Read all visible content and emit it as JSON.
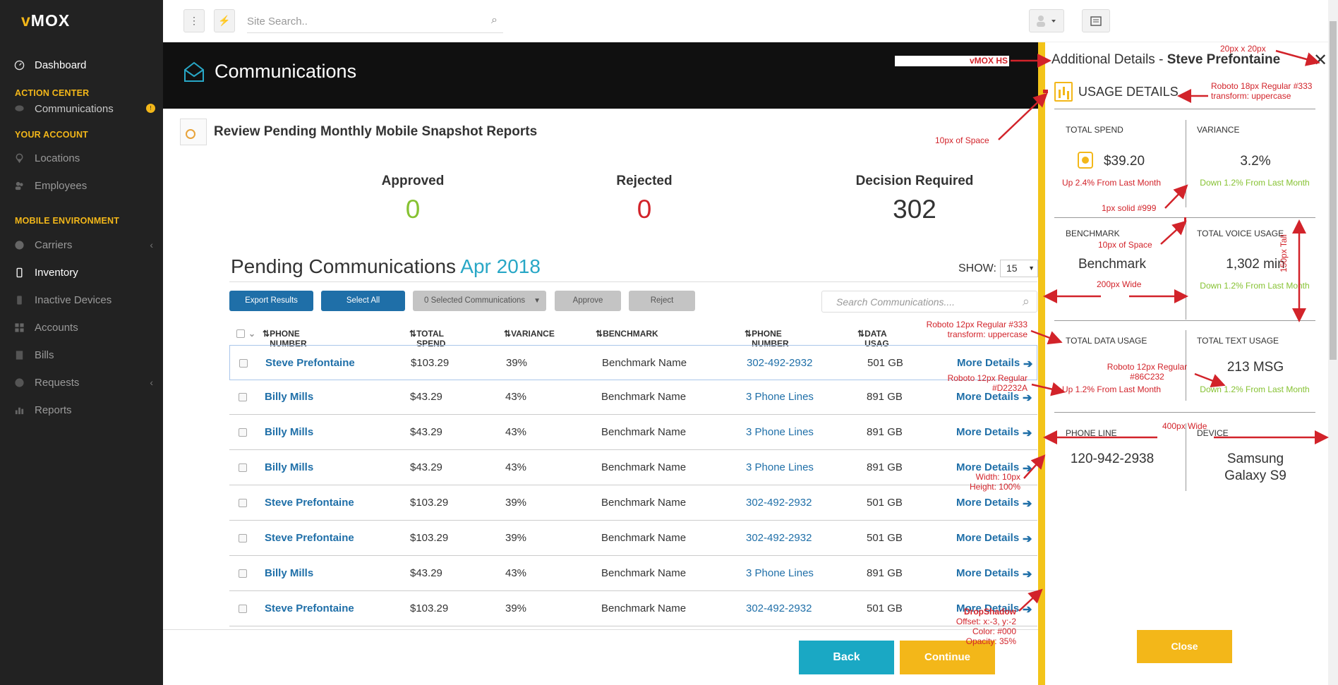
{
  "brand": {
    "logo_v": "v",
    "logo_rest": "MOX",
    "accent": "#f3b719"
  },
  "sidebar": {
    "dashboard": "Dashboard",
    "action_center": "ACTION CENTER",
    "communications": "Communications",
    "communications_badge": "!",
    "your_account": "YOUR ACCOUNT",
    "locations": "Locations",
    "employees": "Employees",
    "mobile_environment": "MOBILE ENVIRONMENT",
    "carriers": "Carriers",
    "inventory": "Inventory",
    "inactive_devices": "Inactive Devices",
    "accounts": "Accounts",
    "bills": "Bills",
    "requests": "Requests",
    "reports": "Reports",
    "chevron": "‹"
  },
  "topbar": {
    "menu_glyph": "⋮",
    "bolt_glyph": "⚡",
    "search_placeholder": "Site Search..",
    "search_glyph": "⌕"
  },
  "header": {
    "title": "Communications",
    "vmox_hs": "vMOX HS"
  },
  "review": {
    "title": "Review Pending Monthly Mobile Snapshot Reports"
  },
  "stats": {
    "approved_label": "Approved",
    "approved_value": "0",
    "rejected_label": "Rejected",
    "rejected_value": "0",
    "decision_label": "Decision Required",
    "decision_value": "302"
  },
  "pending": {
    "title": "Pending Communications",
    "month": "Apr 2018",
    "show_label": "SHOW:",
    "show_value": "15"
  },
  "toolbar": {
    "export": "Export Results",
    "select_all": "Select All",
    "selected": "0 Selected Communications",
    "approve": "Approve",
    "reject": "Reject",
    "search_placeholder": "Search Communications...."
  },
  "table": {
    "headers": [
      "PHONE NUMBER",
      "TOTAL SPEND",
      "VARIANCE",
      "BENCHMARK",
      "PHONE NUMBER",
      "DATA USAG"
    ],
    "more_label": "More Details",
    "arrow": "➔",
    "rows": [
      {
        "name": "Steve Prefontaine",
        "spend": "$103.29",
        "variance": "39%",
        "benchmark": "Benchmark Name",
        "phone": "302-492-2932",
        "data": "501 GB"
      },
      {
        "name": "Billy Mills",
        "spend": "$43.29",
        "variance": "43%",
        "benchmark": "Benchmark Name",
        "phone": "3 Phone Lines",
        "data": "891 GB"
      },
      {
        "name": "Billy Mills",
        "spend": "$43.29",
        "variance": "43%",
        "benchmark": "Benchmark Name",
        "phone": "3 Phone Lines",
        "data": "891 GB"
      },
      {
        "name": "Billy Mills",
        "spend": "$43.29",
        "variance": "43%",
        "benchmark": "Benchmark Name",
        "phone": "3 Phone Lines",
        "data": "891 GB"
      },
      {
        "name": "Steve Prefontaine",
        "spend": "$103.29",
        "variance": "39%",
        "benchmark": "Benchmark Name",
        "phone": "302-492-2932",
        "data": "501 GB"
      },
      {
        "name": "Steve Prefontaine",
        "spend": "$103.29",
        "variance": "39%",
        "benchmark": "Benchmark Name",
        "phone": "302-492-2932",
        "data": "501 GB"
      },
      {
        "name": "Billy Mills",
        "spend": "$43.29",
        "variance": "43%",
        "benchmark": "Benchmark Name",
        "phone": "3 Phone Lines",
        "data": "891 GB"
      },
      {
        "name": "Steve Prefontaine",
        "spend": "$103.29",
        "variance": "39%",
        "benchmark": "Benchmark Name",
        "phone": "302-492-2932",
        "data": "501 GB"
      }
    ]
  },
  "footer": {
    "back": "Back",
    "continue": "Continue"
  },
  "details": {
    "title_prefix": "Additional Details - ",
    "title_name": "Steve Prefontaine",
    "close_glyph": "✕",
    "section": "Usage Details",
    "total_spend_label": "TOTAL SPEND",
    "total_spend_value": "$39.20",
    "total_spend_sub": "Up 2.4% From Last Month",
    "variance_label": "VARIANCE",
    "variance_value": "3.2%",
    "variance_sub": "Down 1.2% From Last Month",
    "benchmark_label": "BENCHMARK",
    "benchmark_value": "Benchmark",
    "voice_label": "TOTAL VOICE USAGE",
    "voice_value": "1,302 min",
    "voice_sub": "Down 1.2% From Last Month",
    "data_label": "TOTAL DATA USAGE",
    "data_sub": "Up 1.2% From Last Month",
    "text_label": "TOTAL TEXT USAGE",
    "text_value": "213 MSG",
    "text_sub": "Down 1.2% From Last Month",
    "phone_line_label": "PHONE LINE",
    "phone_line_value": "120-942-2938",
    "device_label": "DEVICE",
    "device_value_1": "Samsung",
    "device_value_2": "Galaxy S9",
    "close_button": "Close",
    "red": "#d2232a",
    "green": "#86c232"
  },
  "annotations": {
    "size_20": "20px x 20px",
    "roboto18_1": "Roboto 18px Regular #333",
    "roboto18_2": "transform: uppercase",
    "space10_a": "10px of Space",
    "solid999": "1px solid #999",
    "space10_b": "10px of Space",
    "wide200": "200px Wide",
    "tall150": "150px Tall",
    "roboto12_1": "Roboto 12px Regular #333",
    "roboto12_2": "transform: uppercase",
    "roboto12red_1": "Roboto 12px Regular",
    "roboto12red_2": "#D2232A",
    "roboto12green_1": "Roboto 12px Regular",
    "roboto12green_2": "#86C232",
    "wide400": "400px Wide",
    "width10": "Width: 10px",
    "height100": "Height: 100%",
    "drop_1": "DropShadow",
    "drop_2": "Offset: x:-3, y:-2",
    "drop_3": "Color: #000",
    "drop_4": "Opacity: 35%"
  }
}
